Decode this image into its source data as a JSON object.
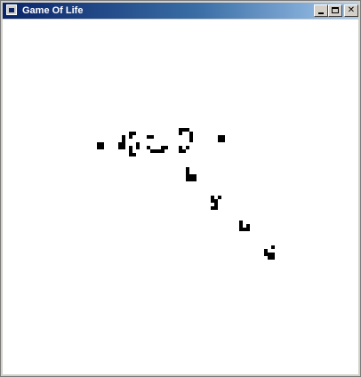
{
  "window": {
    "title": "Game Of Life",
    "icon": "app-window-icon",
    "controls": {
      "minimize_icon": "minimize-icon",
      "maximize_icon": "maximize-icon",
      "close_icon": "close-icon"
    },
    "colors": {
      "title_start": "#0a246a",
      "title_end": "#a6caf0",
      "cell": "#000000",
      "background": "#ffffff"
    }
  },
  "game": {
    "grid_unit": "cell",
    "live_cells": [
      [
        27,
        35
      ],
      [
        28,
        35
      ],
      [
        27,
        36
      ],
      [
        28,
        36
      ],
      [
        36,
        32
      ],
      [
        36,
        33
      ],
      [
        36,
        36
      ],
      [
        36,
        37
      ],
      [
        36,
        38
      ],
      [
        37,
        32
      ],
      [
        37,
        38
      ],
      [
        34,
        33
      ],
      [
        34,
        34
      ],
      [
        34,
        35
      ],
      [
        34,
        36
      ],
      [
        33,
        35
      ],
      [
        33,
        36
      ],
      [
        38,
        35
      ],
      [
        38,
        36
      ],
      [
        41,
        33
      ],
      [
        42,
        33
      ],
      [
        41,
        36
      ],
      [
        42,
        37
      ],
      [
        43,
        37
      ],
      [
        44,
        37
      ],
      [
        45,
        37
      ],
      [
        45,
        36
      ],
      [
        46,
        36
      ],
      [
        50,
        31
      ],
      [
        51,
        31
      ],
      [
        50,
        32
      ],
      [
        52,
        31
      ],
      [
        50,
        36
      ],
      [
        50,
        37
      ],
      [
        51,
        37
      ],
      [
        52,
        36
      ],
      [
        53,
        32
      ],
      [
        53,
        33
      ],
      [
        53,
        34
      ],
      [
        61,
        33
      ],
      [
        62,
        33
      ],
      [
        61,
        34
      ],
      [
        62,
        34
      ],
      [
        52,
        43
      ],
      [
        52,
        44
      ],
      [
        53,
        44
      ],
      [
        54,
        44
      ],
      [
        53,
        45
      ],
      [
        52,
        45
      ],
      [
        54,
        45
      ],
      [
        52,
        42
      ],
      [
        59,
        50
      ],
      [
        59,
        51
      ],
      [
        60,
        51
      ],
      [
        60,
        52
      ],
      [
        60,
        53
      ],
      [
        59,
        53
      ],
      [
        61,
        50
      ],
      [
        67,
        57
      ],
      [
        67,
        58
      ],
      [
        68,
        59
      ],
      [
        69,
        59
      ],
      [
        69,
        58
      ],
      [
        67,
        59
      ],
      [
        74,
        65
      ],
      [
        74,
        66
      ],
      [
        75,
        66
      ],
      [
        75,
        67
      ],
      [
        76,
        67
      ],
      [
        76,
        66
      ],
      [
        76,
        64
      ]
    ]
  }
}
